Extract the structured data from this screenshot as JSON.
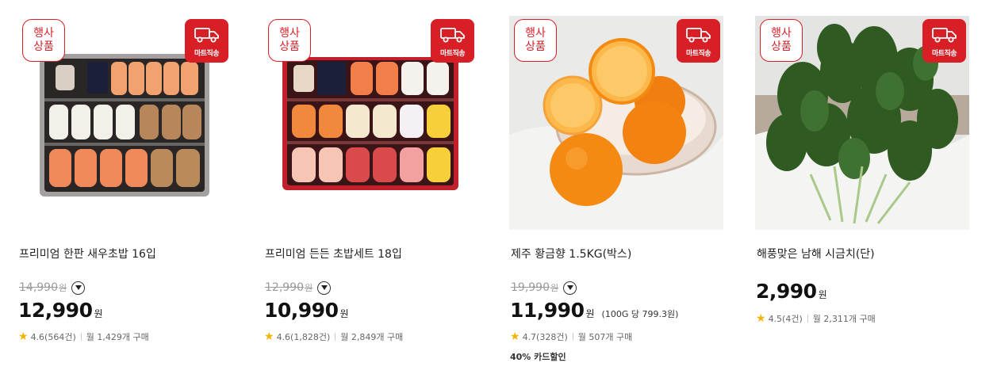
{
  "colors": {
    "accent": "#d81f26",
    "star": "#f5b301",
    "strike": "#9a9a9a"
  },
  "badges": {
    "event_line1": "행사",
    "event_line2": "상품",
    "mart_delivery": "마트직송",
    "truck_icon": "delivery-truck-icon"
  },
  "currency": "원",
  "products": [
    {
      "title": "프리미엄 한판 새우초밥 16입",
      "original_price": "14,990",
      "price": "12,990",
      "rating": "4.6(564건)",
      "monthly": "월 1,429개 구매"
    },
    {
      "title": "프리미엄 든든 초밥세트 18입",
      "original_price": "12,990",
      "price": "10,990",
      "rating": "4.6(1,828건)",
      "monthly": "월 2,849개 구매"
    },
    {
      "title": "제주 황금향 1.5KG(박스)",
      "original_price": "19,990",
      "price": "11,990",
      "unit_price": "(100G 당 799.3원)",
      "rating": "4.7(328건)",
      "monthly": "월 507개 구매",
      "card_discount": "40% 카드할인"
    },
    {
      "title": "해풍맞은 남해 시금치(단)",
      "price": "2,990",
      "rating": "4.5(4건)",
      "monthly": "월 2,311개 구매"
    }
  ]
}
